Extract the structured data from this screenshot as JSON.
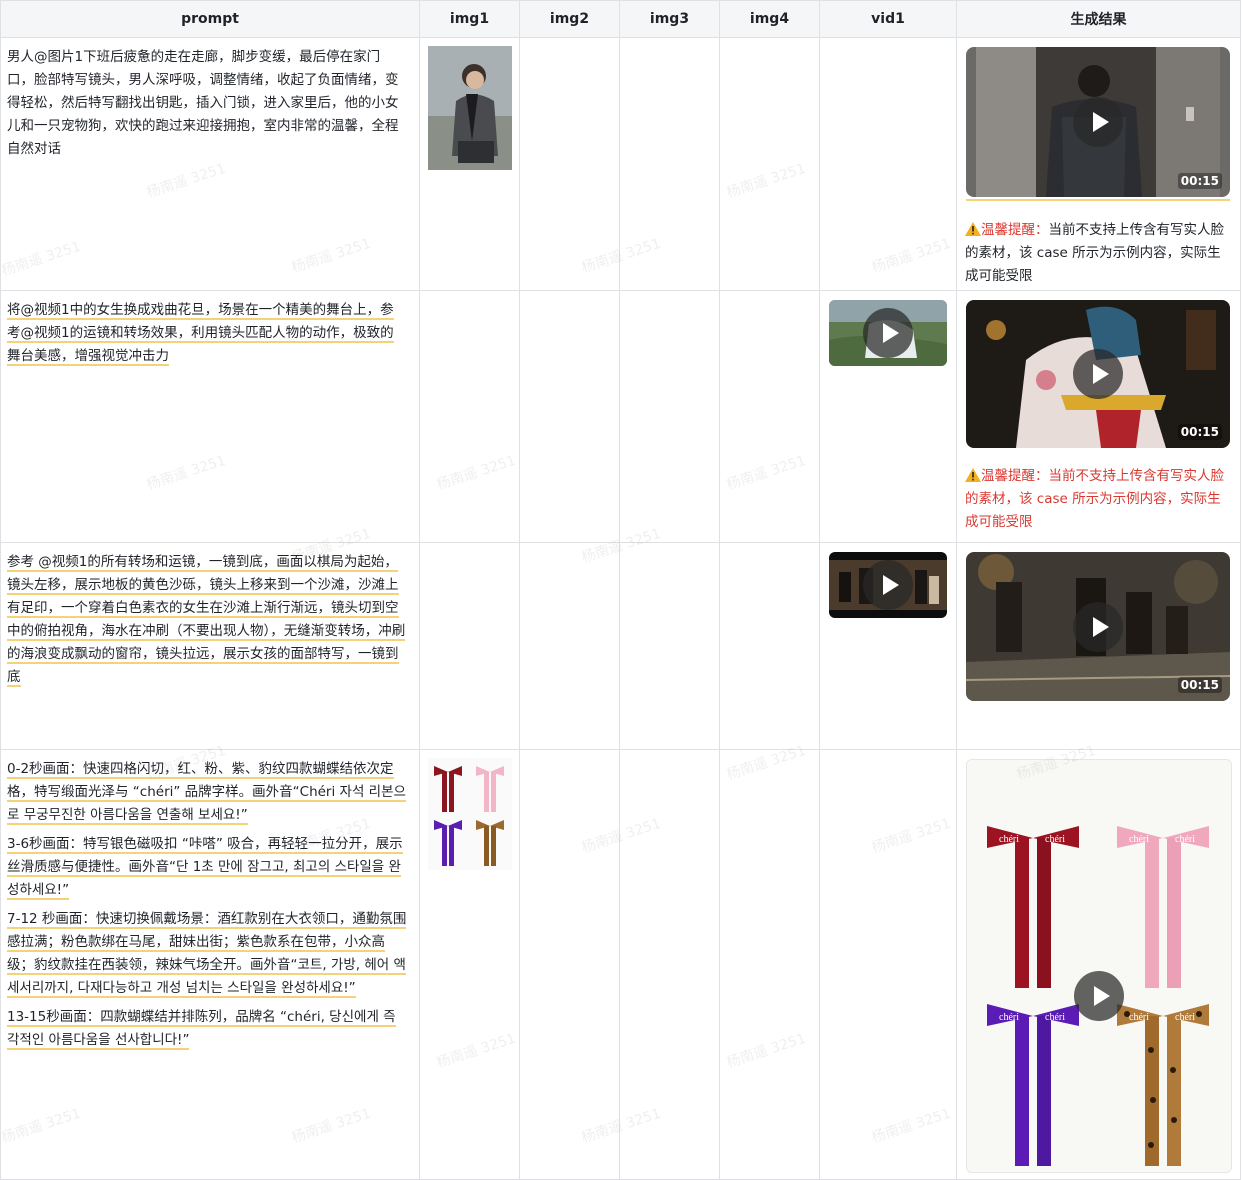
{
  "columns": [
    "prompt",
    "img1",
    "img2",
    "img3",
    "img4",
    "vid1",
    "生成结果"
  ],
  "rows": [
    {
      "prompt": [
        "男人@图片1下班后疲惫的走在走廊，脚步变缓，最后停在家门口，脸部特写镜头，男人深呼吸，调整情绪，收起了负面情绪，变得轻松，然后特写翻找出钥匙，插入门锁，进入家里后，他的小女儿和一只宠物狗，欢快的跑过来迎接拥抱，室内非常的温馨，全程自然对话"
      ],
      "result_duration": "00:15",
      "warning_label": "温馨提醒：",
      "warning_text": "当前不支持上传含有写实人脸的素材，该 case 所示为示例内容，实际生成可能受限"
    },
    {
      "prompt": [
        "将@视频1中的女生换成戏曲花旦，场景在一个精美的舞台上，参考@视频1的运镜和转场效果，利用镜头匹配人物的动作，极致的舞台美感，增强视觉冲击力"
      ],
      "result_duration": "00:15",
      "warning_label": "温馨提醒：",
      "warning_text": "当前不支持上传含有写实人脸的素材，该 case 所示为示例内容，实际生成可能受限"
    },
    {
      "prompt": [
        "参考 @视频1的所有转场和运镜，一镜到底，画面以棋局为起始，镜头左移，展示地板的黄色沙砾，镜头上移来到一个沙滩，沙滩上有足印，一个穿着白色素衣的女生在沙滩上渐行渐远，镜头切到空中的俯拍视角，海水在冲刷（不要出现人物），无缝渐变转场，冲刷的海浪变成飘动的窗帘，镜头拉远，展示女孩的面部特写，一镜到底"
      ],
      "result_duration": "00:15"
    },
    {
      "prompt": [
        "0-2秒画面：快速四格闪切，红、粉、紫、豹纹四款蝴蝶结依次定格，特写缎面光泽与 “chéri” 品牌字样。画外音“Chéri 자석 리본으로 무궁무진한 아름다움을 연출해 보세요!”",
        "3-6秒画面：特写银色磁吸扣 “咔嗒” 吸合，再轻轻一拉分开，展示丝滑质感与便捷性。画外音“단 1초 만에 잠그고, 최고의 스타일을 완성하세요!”",
        "7-12 秒画面：快速切换佩戴场景：酒红款别在大衣领口，通勤氛围感拉满；粉色款绑在马尾，甜妹出街；紫色款系在包带，小众高级；豹纹款挂在西装领，辣妹气场全开。画外音“코트, 가방, 헤어 액세서리까지, 다재다능하고 개성 넘치는 스타일을 완성하세요!”",
        "13-15秒画面：四款蝴蝶结并排陈列，品牌名 “chéri, 당신에게 즉각적인 아름다움을 선사합니다!”"
      ],
      "brand": "chéri"
    }
  ],
  "watermark": "杨南遥 3251",
  "colors": {
    "header_bg": "#f5f6f7",
    "border": "#dee0e3",
    "warning_red": "#d83931",
    "underline": "#f5d27a"
  }
}
